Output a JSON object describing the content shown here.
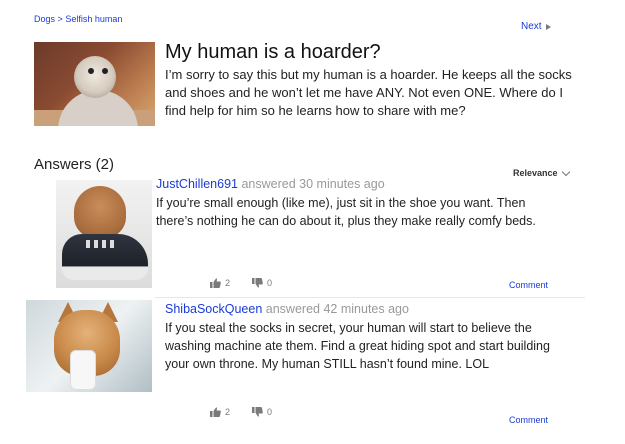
{
  "breadcrumb": {
    "parent": "Dogs",
    "separator": ">",
    "current": "Selfish human"
  },
  "nav": {
    "next_label": "Next",
    "next_icon": "triangle-right-icon"
  },
  "question": {
    "title": "My human is a hoarder?",
    "body": "I’m sorry to say this but my human is a hoarder. He keeps all the socks and shoes and he won’t let me have ANY. Not even ONE. Where do I find help for him so he learns how to share with me?"
  },
  "answers_header": "Answers (2)",
  "sort": {
    "label": "Relevance",
    "icon": "chevron-down-icon"
  },
  "answers": [
    {
      "author": "JustChillen691",
      "answered_word": "answered",
      "time": "30 minutes ago",
      "body": "If you’re small enough (like me), just sit in the shoe you want. Then there’s nothing he can do about it, plus they make really comfy beds.",
      "upvotes": "2",
      "downvotes": "0",
      "comment_label": "Comment"
    },
    {
      "author": "ShibaSockQueen",
      "answered_word": "answered",
      "time": "42 minutes ago",
      "body": "If you steal the socks in secret, your human will start to believe the washing machine ate them. Find a great hiding spot and start building your own throne. My human STILL hasn’t found mine. LOL",
      "upvotes": "2",
      "downvotes": "0",
      "comment_label": "Comment"
    }
  ],
  "colors": {
    "link": "#1a3bd6",
    "muted": "#999999",
    "icon_gray": "#7a7a7a"
  }
}
